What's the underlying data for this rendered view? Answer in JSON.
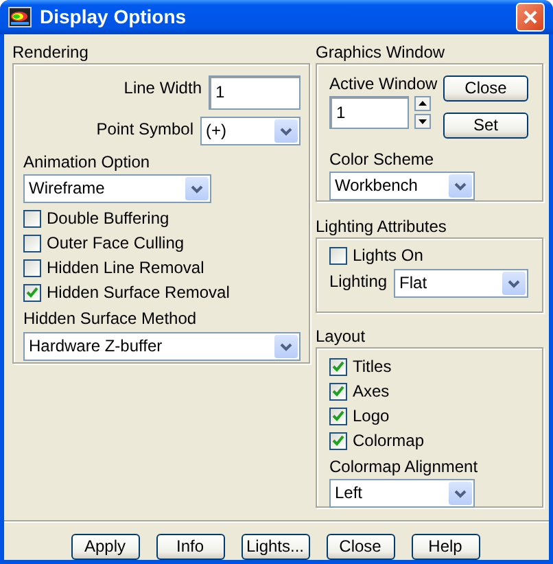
{
  "window": {
    "title": "Display Options"
  },
  "rendering": {
    "title": "Rendering",
    "line_width": {
      "label": "Line Width",
      "value": "1"
    },
    "point_symbol": {
      "label": "Point Symbol",
      "value": "(+)"
    },
    "animation_option": {
      "label": "Animation Option",
      "value": "Wireframe"
    },
    "options": [
      {
        "label": "Double Buffering",
        "checked": false
      },
      {
        "label": "Outer Face Culling",
        "checked": false
      },
      {
        "label": "Hidden Line Removal",
        "checked": false
      },
      {
        "label": "Hidden Surface Removal",
        "checked": true
      }
    ],
    "hidden_surface_method": {
      "label": "Hidden Surface Method",
      "value": "Hardware Z-buffer"
    }
  },
  "graphics_window": {
    "title": "Graphics Window",
    "active_window": {
      "label": "Active Window",
      "value": "1"
    },
    "buttons": [
      "Close",
      "Set"
    ],
    "color_scheme": {
      "label": "Color Scheme",
      "value": "Workbench"
    }
  },
  "lighting_attributes": {
    "title": "Lighting Attributes",
    "lights_on": {
      "label": "Lights On",
      "checked": false
    },
    "lighting": {
      "label": "Lighting",
      "value": "Flat"
    }
  },
  "layout": {
    "title": "Layout",
    "options": [
      {
        "label": "Titles",
        "checked": true
      },
      {
        "label": "Axes",
        "checked": true
      },
      {
        "label": "Logo",
        "checked": true
      },
      {
        "label": "Colormap",
        "checked": true
      }
    ],
    "colormap_alignment": {
      "label": "Colormap Alignment",
      "value": "Left"
    }
  },
  "buttons": [
    "Apply",
    "Info",
    "Lights...",
    "Close",
    "Help"
  ]
}
